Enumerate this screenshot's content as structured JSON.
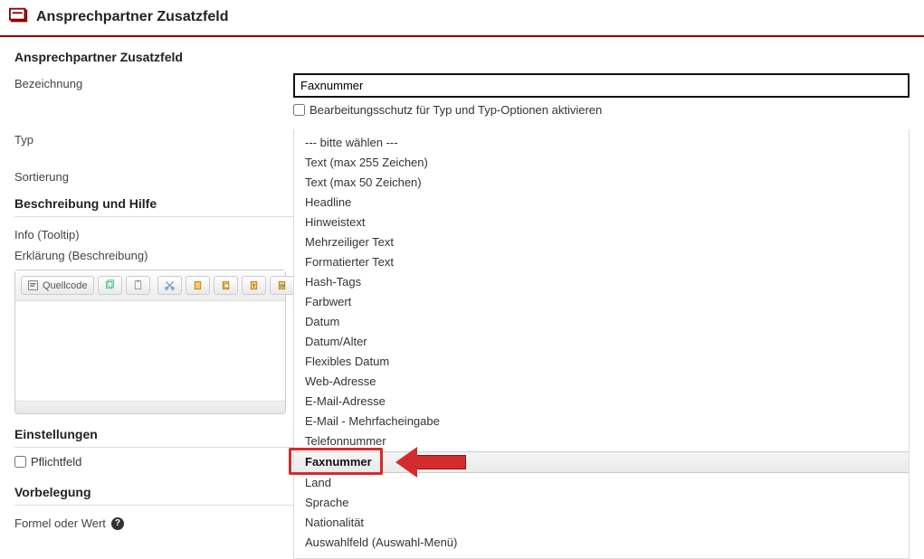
{
  "header": {
    "title": "Ansprechpartner Zusatzfeld"
  },
  "form": {
    "section_title": "Ansprechpartner Zusatzfeld",
    "bezeichnung_label": "Bezeichnung",
    "bezeichnung_value": "Faxnummer",
    "protect_checkbox_label": "Bearbeitungsschutz für Typ und Typ-Optionen aktivieren",
    "typ_label": "Typ",
    "typ_placeholder": "--- bitte wählen ---",
    "sortierung_label": "Sortierung",
    "beschreibung_heading": "Beschreibung und Hilfe",
    "info_label": "Info (Tooltip)",
    "erklaerung_label": "Erklärung (Beschreibung)",
    "einstellungen_heading": "Einstellungen",
    "pflichtfeld_label": "Pflichtfeld",
    "vorbelegung_heading": "Vorbelegung",
    "formel_label": "Formel oder Wert"
  },
  "editor": {
    "quellcode_label": "Quellcode"
  },
  "dropdown": {
    "highlight_index": 17,
    "items": [
      "--- bitte wählen ---",
      "Text (max 255 Zeichen)",
      "Text (max 50 Zeichen)",
      "Headline",
      "Hinweistext",
      "Mehrzeiliger Text",
      "Formatierter Text",
      "Hash-Tags",
      "Farbwert",
      "Datum",
      "Datum/Alter",
      "Flexibles Datum",
      "Web-Adresse",
      "E-Mail-Adresse",
      "E-Mail - Mehrfacheingabe",
      "Telefonnummer",
      "Faxnummer",
      "Land",
      "Sprache",
      "Nationalität",
      "Auswahlfeld (Auswahl-Menü)"
    ]
  },
  "colors": {
    "accent": "#8b0000",
    "annotation": "#d42c2c"
  }
}
